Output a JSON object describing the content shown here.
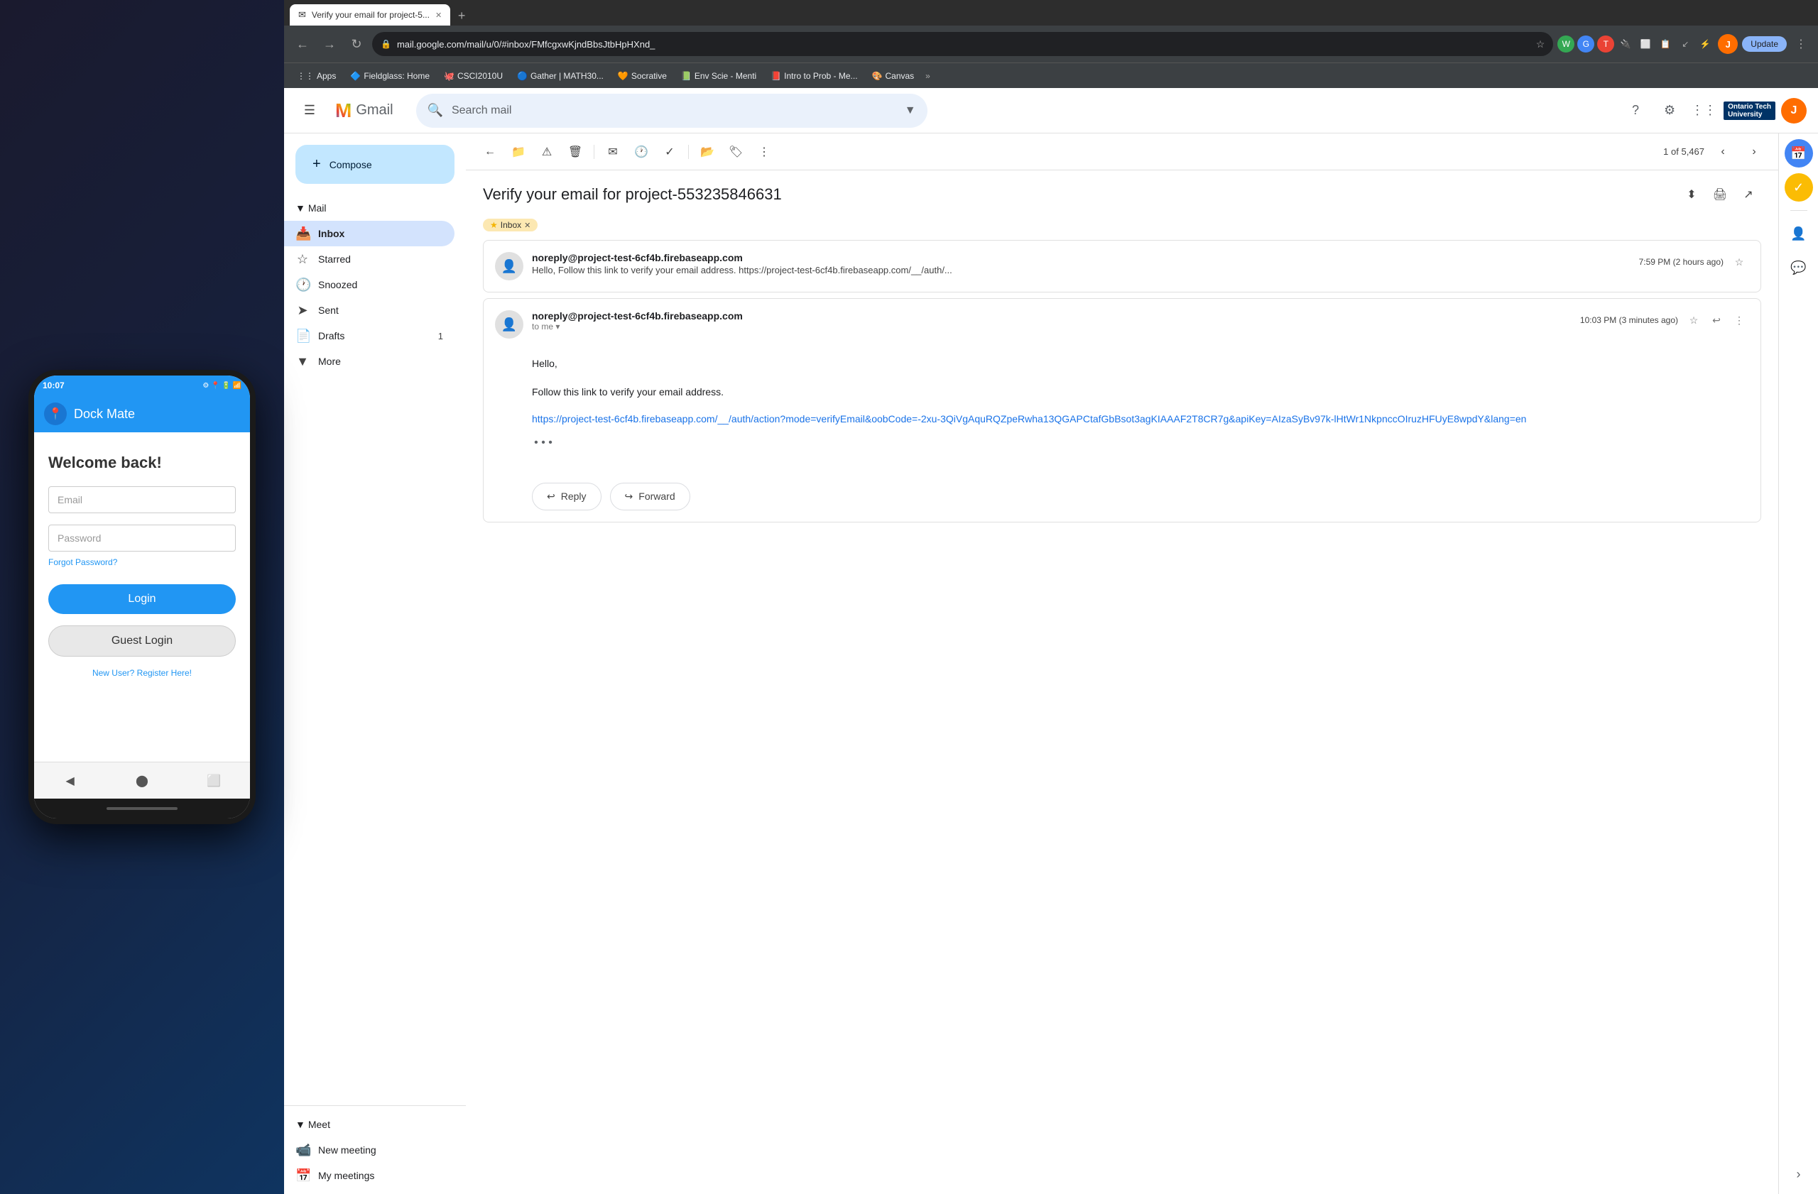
{
  "phone": {
    "status_time": "10:07",
    "status_icons": "⚙ 📍 🔋",
    "app_title": "Dock Mate",
    "welcome": "Welcome back!",
    "email_placeholder": "Email",
    "password_placeholder": "Password",
    "forgot_password": "Forgot Password?",
    "login_btn": "Login",
    "guest_btn": "Guest Login",
    "register_link": "New User? Register Here!"
  },
  "browser": {
    "tab_title": "Verify your email for project-5...",
    "tab_new_label": "+",
    "address": "mail.google.com/mail/u/0/#inbox/FMfcgxwKjndBbsJtbHpHXnd_",
    "update_btn": "Update",
    "bookmarks": [
      {
        "label": "Apps",
        "icon": "⋮⋮"
      },
      {
        "label": "Fieldglass: Home",
        "icon": "🔷"
      },
      {
        "label": "CSCI2010U",
        "icon": "🐙"
      },
      {
        "label": "Gather | MATH30...",
        "icon": "🔵"
      },
      {
        "label": "Socrative",
        "icon": "🧡"
      },
      {
        "label": "Env Scie - Menti",
        "icon": "📗"
      },
      {
        "label": "Intro to Prob - Me...",
        "icon": "📕"
      },
      {
        "label": "Canvas",
        "icon": "🎨"
      }
    ]
  },
  "gmail": {
    "logo_text": "Gmail",
    "search_placeholder": "Search mail",
    "sidebar": {
      "mail_label": "Mail",
      "compose_label": "Compose",
      "items": [
        {
          "id": "inbox",
          "label": "Inbox",
          "icon": "📥",
          "active": true
        },
        {
          "id": "starred",
          "label": "Starred",
          "icon": "☆"
        },
        {
          "id": "snoozed",
          "label": "Snoozed",
          "icon": "🕐"
        },
        {
          "id": "sent",
          "label": "Sent",
          "icon": "➤"
        },
        {
          "id": "drafts",
          "label": "Drafts",
          "icon": "📄",
          "count": "1"
        },
        {
          "id": "more",
          "label": "More",
          "icon": "▼"
        }
      ],
      "meet_label": "Meet",
      "meet_items": [
        {
          "id": "new-meeting",
          "label": "New meeting",
          "icon": "📹"
        },
        {
          "id": "my-meetings",
          "label": "My meetings",
          "icon": "📅"
        }
      ]
    },
    "thread": {
      "subject": "Verify your email for project-553235846631",
      "inbox_tag": "Inbox",
      "pagination": "1 of 5,467",
      "messages": [
        {
          "from": "noreply@project-test-6cf4b.firebaseapp.com",
          "time": "7:59 PM (2 hours ago)",
          "preview": "Hello, Follow this link to verify your email address. https://project-test-6cf4b.firebaseapp.com/__/auth/...",
          "expanded": false
        },
        {
          "from": "noreply@project-test-6cf4b.firebaseapp.com",
          "to": "to me",
          "time": "10:03 PM (3 minutes ago)",
          "expanded": true,
          "body_greeting": "Hello,",
          "body_text": "Follow this link to verify your email address.",
          "link": "https://project-test-6cf4b.firebaseapp.com/__/auth/action?mode=verifyEmail&oobCode=-2xu-3QiVgAquRQZpeRwha13QGAPCtafGbBsot3agKIAAAF2T8CR7g&apiKey=AIzaSyBv97k-lHtWr1NkpnccOIruzHFUyE8wpdY&lang=en"
        }
      ],
      "reply_btn": "Reply",
      "forward_btn": "Forward"
    }
  }
}
